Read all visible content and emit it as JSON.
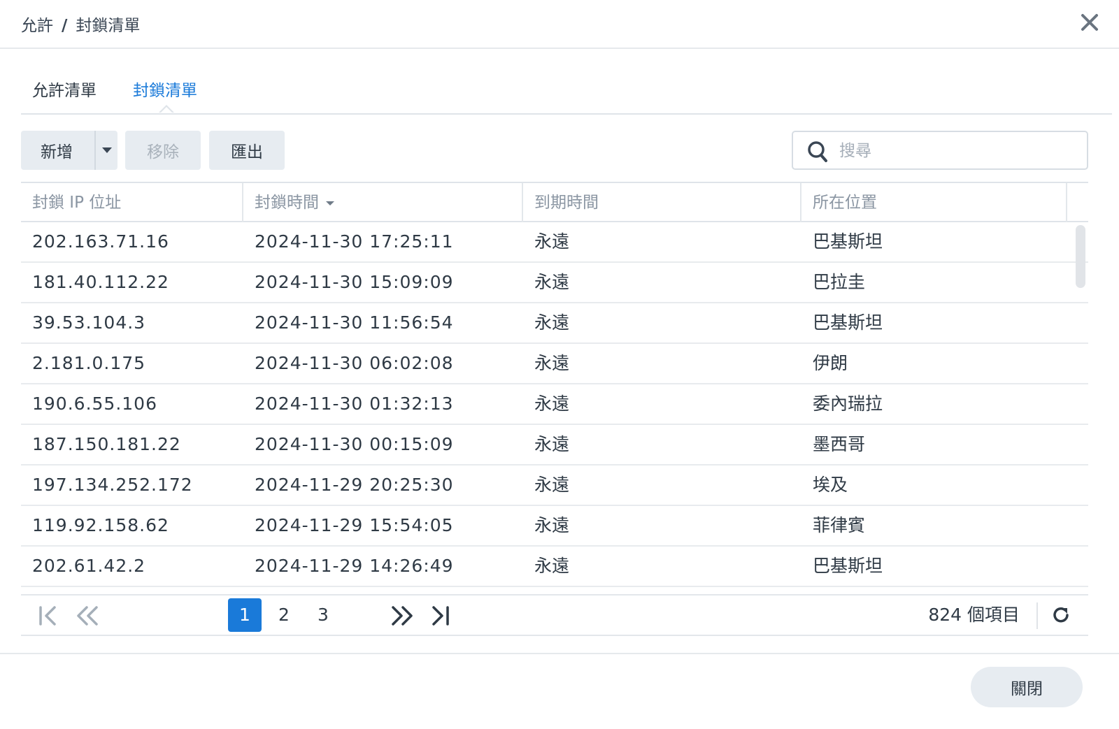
{
  "window": {
    "breadcrumb": [
      "允許",
      "/",
      "封鎖清單"
    ],
    "close_icon": "close-icon"
  },
  "tabs": [
    {
      "label": "允許清單",
      "active": false
    },
    {
      "label": "封鎖清單",
      "active": true
    }
  ],
  "toolbar": {
    "add_label": "新增",
    "remove_label": "移除",
    "export_label": "匯出",
    "search_placeholder": "搜尋",
    "search_value": ""
  },
  "grid": {
    "columns": [
      {
        "label": "封鎖 IP 位址"
      },
      {
        "label": "封鎖時間",
        "sorted": "desc"
      },
      {
        "label": "到期時間"
      },
      {
        "label": "所在位置"
      }
    ],
    "rows": [
      {
        "ip": "202.163.71.16",
        "blocked": "2024-11-30 17:25:11",
        "expires": "永遠",
        "location": "巴基斯坦"
      },
      {
        "ip": "181.40.112.22",
        "blocked": "2024-11-30 15:09:09",
        "expires": "永遠",
        "location": "巴拉圭"
      },
      {
        "ip": "39.53.104.3",
        "blocked": "2024-11-30 11:56:54",
        "expires": "永遠",
        "location": "巴基斯坦"
      },
      {
        "ip": "2.181.0.175",
        "blocked": "2024-11-30 06:02:08",
        "expires": "永遠",
        "location": "伊朗"
      },
      {
        "ip": "190.6.55.106",
        "blocked": "2024-11-30 01:32:13",
        "expires": "永遠",
        "location": "委內瑞拉"
      },
      {
        "ip": "187.150.181.22",
        "blocked": "2024-11-30 00:15:09",
        "expires": "永遠",
        "location": "墨西哥"
      },
      {
        "ip": "197.134.252.172",
        "blocked": "2024-11-29 20:25:30",
        "expires": "永遠",
        "location": "埃及"
      },
      {
        "ip": "119.92.158.62",
        "blocked": "2024-11-29 15:54:05",
        "expires": "永遠",
        "location": "菲律賓"
      },
      {
        "ip": "202.61.42.2",
        "blocked": "2024-11-29 14:26:49",
        "expires": "永遠",
        "location": "巴基斯坦"
      }
    ]
  },
  "pager": {
    "pages": [
      "1",
      "2",
      "3"
    ],
    "current_page": "1",
    "item_count": "824 個項目"
  },
  "footer": {
    "close_label": "關閉"
  },
  "colors": {
    "accent": "#1a7ad9",
    "button_bg": "#e7ecf1",
    "header_text": "#8a95a2"
  }
}
